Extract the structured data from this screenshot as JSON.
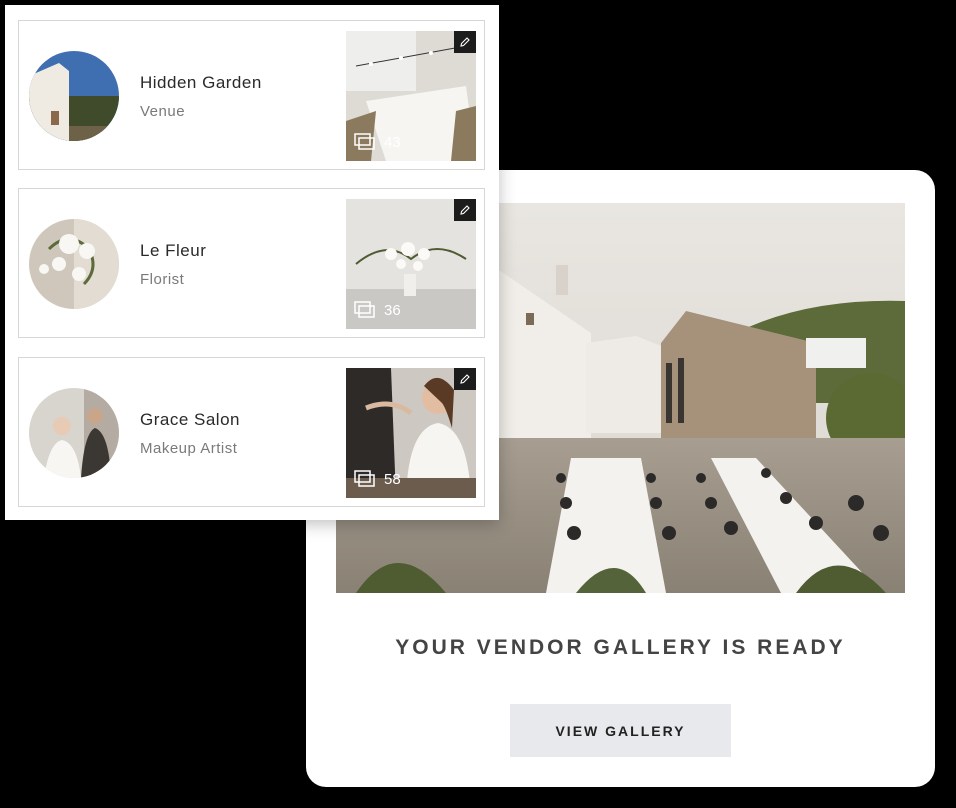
{
  "vendors": [
    {
      "name": "Hidden Garden",
      "category": "Venue",
      "photo_count": "43",
      "edit_icon": "pencil-icon",
      "gallery_icon": "stacked-photos-icon"
    },
    {
      "name": "Le Fleur",
      "category": "Florist",
      "photo_count": "36",
      "edit_icon": "pencil-icon",
      "gallery_icon": "stacked-photos-icon"
    },
    {
      "name": "Grace Salon",
      "category": "Makeup Artist",
      "photo_count": "58",
      "edit_icon": "pencil-icon",
      "gallery_icon": "stacked-photos-icon"
    }
  ],
  "gallery": {
    "headline": "YOUR VENDOR GALLERY IS READY",
    "button_label": "VIEW GALLERY"
  },
  "colors": {
    "background": "#000000",
    "card": "#ffffff",
    "button_bg": "#e8e9ec",
    "edit_badge": "#1c1c1c"
  }
}
